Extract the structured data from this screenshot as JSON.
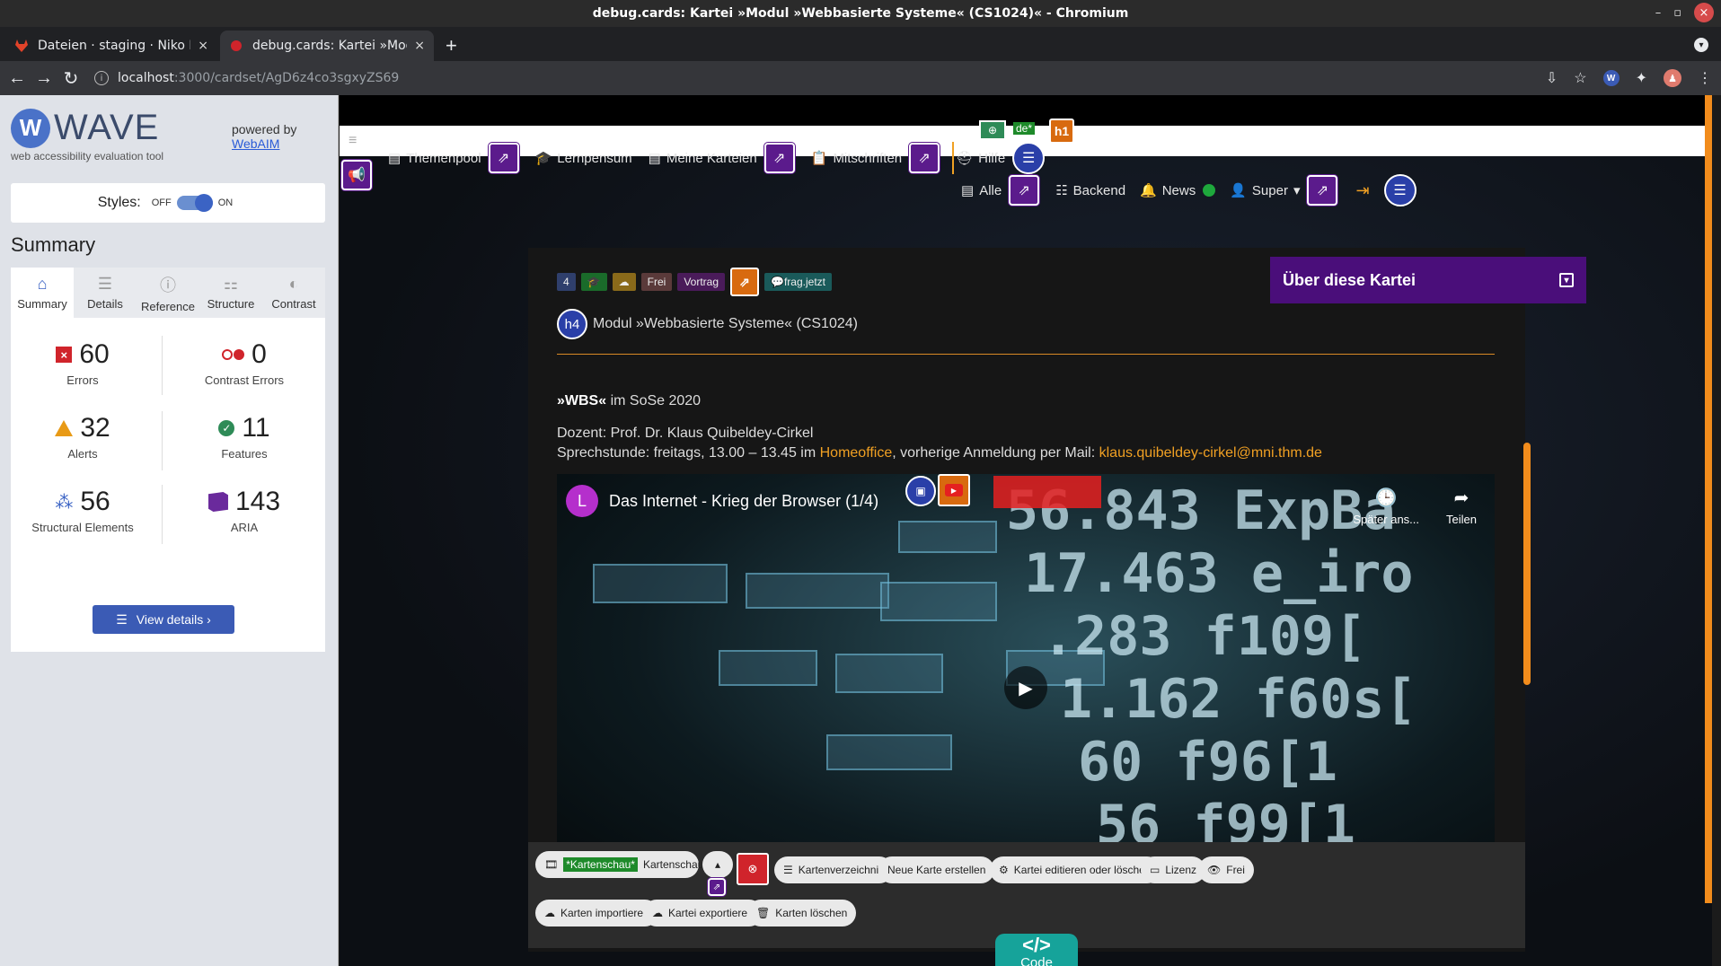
{
  "window": {
    "title": "debug.cards: Kartei »Modul »Webbasierte Systeme« (CS1024)« - Chromium"
  },
  "tabs": [
    {
      "title": "Dateien · staging · Niko M",
      "close": "×"
    },
    {
      "title": "debug.cards: Kartei »Mod",
      "close": "×"
    }
  ],
  "newtab": "+",
  "address": {
    "host": "localhost",
    "path": ":3000/cardset/AgD6z4co3sgxyZS69"
  },
  "wave": {
    "brand": "WAVE",
    "tagline": "web accessibility evaluation tool",
    "powered_by": "powered by",
    "webaim": "WebAIM",
    "styles_label": "Styles:",
    "styles_off": "OFF",
    "styles_on": "ON",
    "summary_heading": "Summary",
    "tabs": [
      "Summary",
      "Details",
      "Reference",
      "Structure",
      "Contrast"
    ],
    "stats": {
      "errors": {
        "value": "60",
        "label": "Errors"
      },
      "contrast": {
        "value": "0",
        "label": "Contrast Errors"
      },
      "alerts": {
        "value": "32",
        "label": "Alerts"
      },
      "features": {
        "value": "11",
        "label": "Features"
      },
      "structural": {
        "value": "56",
        "label": "Structural Elements"
      },
      "aria": {
        "value": "143",
        "label": "ARIA"
      }
    },
    "view_details": "View details ›"
  },
  "site": {
    "lang": "de*",
    "h1": "h1",
    "nav": {
      "themenpool": "Themenpool",
      "lernpensum": "Lernpensum",
      "meine_karteien": "Meine Karteien",
      "mitschriften": "Mitschriften",
      "hilfe": "Hilfe"
    },
    "nav2": {
      "alle": "Alle",
      "backend": "Backend",
      "news": "News",
      "super": "Super"
    },
    "badges": {
      "count": "4",
      "frei": "Frei",
      "vortrag": "Vortrag",
      "fragjetzt": "frag.jetzt"
    },
    "about": "Über diese Kartei",
    "h4": "h4",
    "heading": "Modul »Webbasierte Systeme« (CS1024)",
    "semester_bold": "»WBS«",
    "semester_rest": " im SoSe 2020",
    "dozent": "Dozent: Prof. Dr. Klaus Quibeldey-Cirkel",
    "sprech_prefix": "Sprechstunde: freitags, 13.00 – 13.45 im ",
    "homeoffice": "Homeoffice",
    "sprech_mid": ", vorherige Anmeldung per Mail: ",
    "mail": "klaus.quibeldey-cirkel@mni.thm.de",
    "video": {
      "channel_initial": "L",
      "title": "Das Internet - Krieg der Browser (1/4)",
      "later": "Später ans...",
      "share": "Teilen"
    },
    "footer": {
      "kartenschau_hl": "*Kartenschau*",
      "kartenschau": "Kartenschau",
      "kartenverzeichnis": "Kartenverzeichnis",
      "neue_karte": "Neue Karte erstellen",
      "kartei_edit": "Kartei editieren oder löschen",
      "lizenz": "Lizenz",
      "frei": "Frei",
      "import": "Karten importieren",
      "export": "Kartei exportieren",
      "delete": "Karten löschen"
    },
    "code_symbol": "</>",
    "code_label": "Code"
  }
}
